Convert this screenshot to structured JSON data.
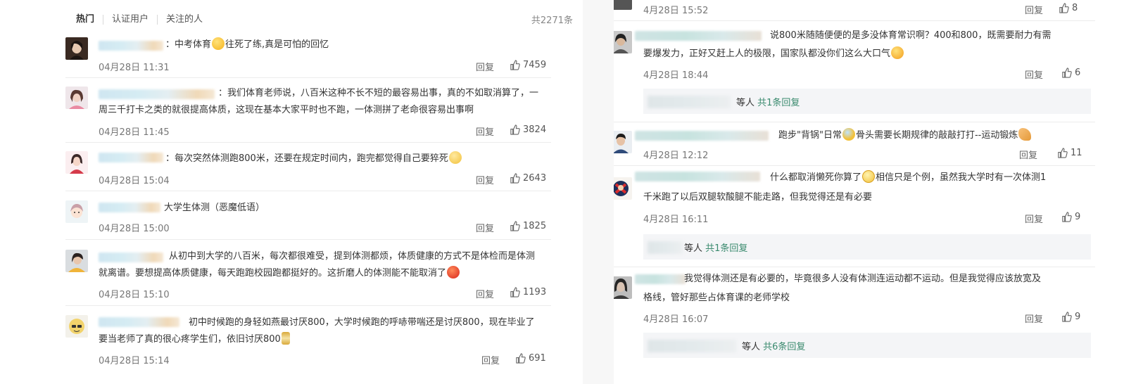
{
  "left": {
    "tabs": [
      "热门",
      "认证用户",
      "关注的人"
    ],
    "total": "共2271条",
    "comments": [
      {
        "text": "：中考体育",
        "text2": "往死了练,真是可怕的回忆",
        "time": "04月28日 11:31",
        "reply": "回复",
        "likes": "7459"
      },
      {
        "text": "：我们体育老师说，八百米这种不长不短的最容易出事，真的不如取消算了，一",
        "text2": "周三千打卡之类的就很提高体质，这现在基本大家平时也不跑，一体测拼了老命很容易出事啊",
        "time": "04月28日 11:45",
        "reply": "回复",
        "likes": "3824"
      },
      {
        "text": "：每次突然体测跑800米，还要在规定时间内，跑完都觉得自己要猝死",
        "time": "04月28日 15:04",
        "reply": "回复",
        "likes": "2643"
      },
      {
        "text": "大学生体测（恶魔低语）",
        "time": "04月28日 15:00",
        "reply": "回复",
        "likes": "1825"
      },
      {
        "text": "从初中到大学的八百米，每次都很难受，提到体测都烦，体质健康的方式不是体检而是体测",
        "text2": "就离谱。要想提高体质健康，每天跑跑校园跑都挺好的。这折磨人的体测能不能取消了",
        "time": "04月28日 15:10",
        "reply": "回复",
        "likes": "1193"
      },
      {
        "text": "初中时候跑的身轻如燕最讨厌800，大学时候跑的呼哧带喘还是讨厌800，现在毕业了",
        "text2": "要当老师了真的很心疼学生们，依旧讨厌800",
        "time": "04月28日 15:14",
        "reply": "回复",
        "likes": "691"
      }
    ]
  },
  "right": {
    "top_partial": {
      "time": "4月28日 15:52",
      "reply": "回复",
      "likes": "8"
    },
    "comments": [
      {
        "text": "说800米随随便便的是多没体育常识啊？400和800，既需要耐力有需",
        "text2": "要爆发力，正好又赶上人的极限，国家队都没你们这么大口气",
        "time": "4月28日 18:44",
        "reply": "回复",
        "likes": "6",
        "sub": {
          "label": "等人",
          "count": "共1条回复"
        }
      },
      {
        "text": "跑步\"背锅\"日常",
        "text2": "骨头需要长期规律的敲敲打打--运动锻炼",
        "time": "4月28日 12:12",
        "reply": "回复",
        "likes": "11"
      },
      {
        "text": "什么都取消懒死你算了",
        "text2": "相信只是个例，虽然我大学时有一次体测1",
        "text3": "千米跑了以后双腿软酸腿不能走路，但我觉得还是有必要",
        "time": "4月28日 16:11",
        "reply": "回复",
        "likes": "9",
        "sub": {
          "label": "等人",
          "count": "共1条回复"
        }
      },
      {
        "text": "我觉得体测还是有必要的，毕竟很多人没有体测连运动都不运动。但是我觉得应该放宽及",
        "text2": "格线，管好那些占体育课的老师学校",
        "time": "4月28日 16:07",
        "reply": "回复",
        "likes": "9",
        "sub": {
          "label": "等人",
          "count": "共6条回复"
        }
      }
    ]
  }
}
